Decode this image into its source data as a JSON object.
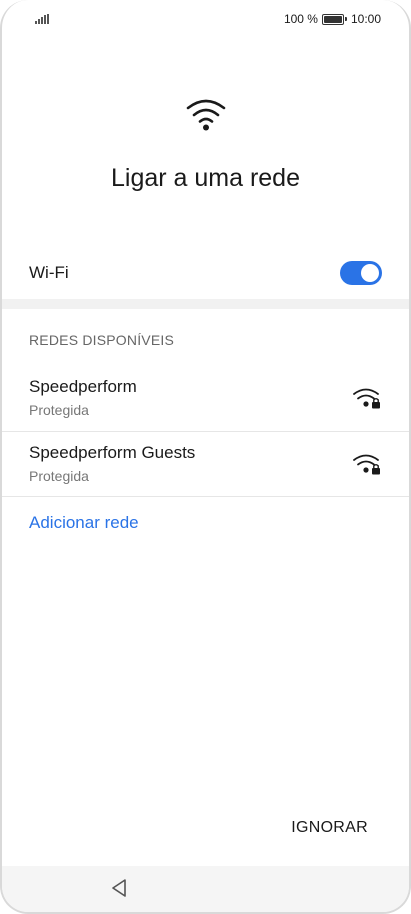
{
  "status_bar": {
    "battery_percent": "100 %",
    "time": "10:00",
    "battery_level": 1.0,
    "signal_icon": "signal-bars-icon",
    "battery_icon": "battery-icon"
  },
  "header": {
    "icon": "wifi-icon",
    "title": "Ligar a uma rede"
  },
  "wifi": {
    "label": "Wi-Fi",
    "enabled": true,
    "accent_color": "#2a73e6"
  },
  "networks": {
    "section_title": "REDES DISPONÍVEIS",
    "items": [
      {
        "name": "Speedperform",
        "status": "Protegida",
        "icon": "wifi-locked-icon"
      },
      {
        "name": "Speedperform Guests",
        "status": "Protegida",
        "icon": "wifi-locked-icon"
      }
    ],
    "add_label": "Adicionar rede"
  },
  "actions": {
    "skip_label": "IGNORAR"
  },
  "nav": {
    "back_icon": "back-icon"
  }
}
